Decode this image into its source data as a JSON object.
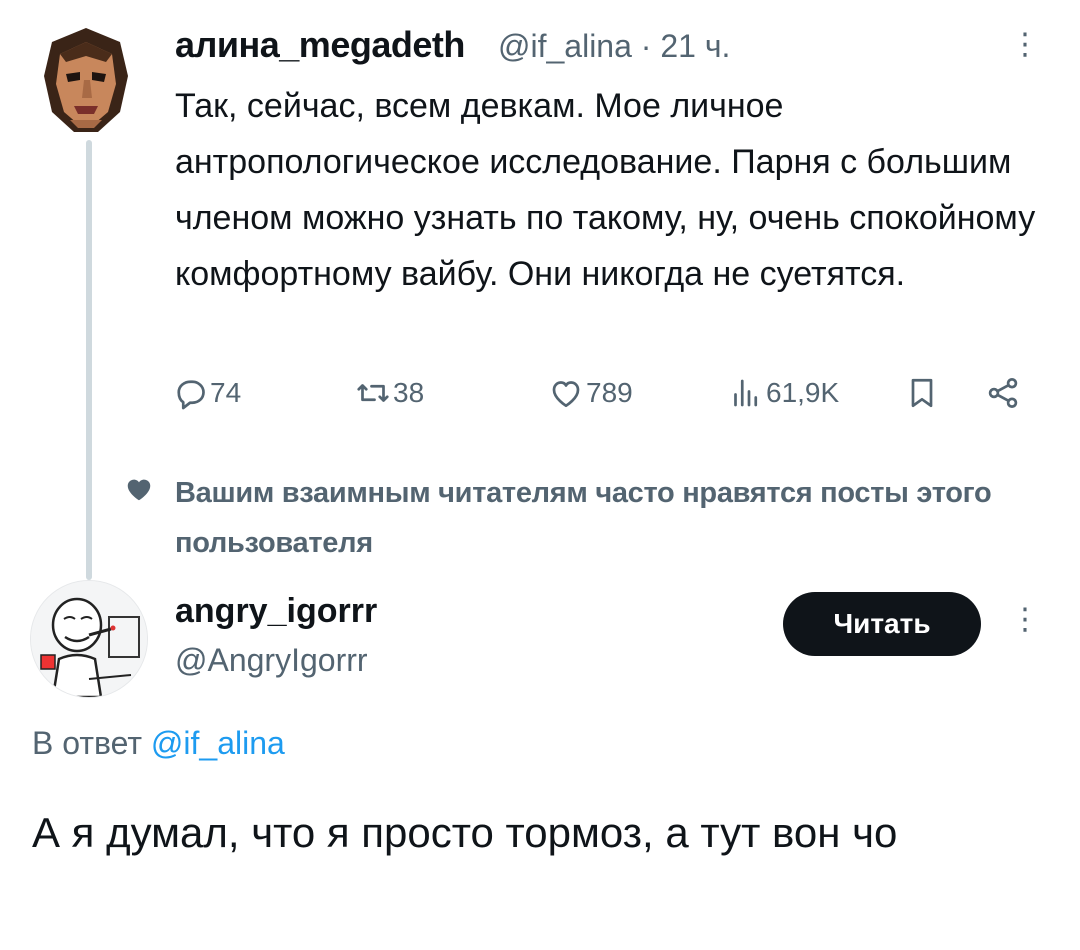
{
  "tweet": {
    "author_name": "алина_megadeth",
    "author_handle": "@if_alina",
    "time": "· 21 ч.",
    "more_label": "⋮",
    "text": "Так, сейчас, всем девкам. Мое личное антропологическое исследование. Парня с большим членом можно узнать по такому, ну, очень спокойному комфортному вайбу. Они никогда не суетятся.",
    "actions": {
      "replies": "74",
      "reposts": "38",
      "likes": "789",
      "views": "61,9K"
    }
  },
  "hint": {
    "text": "Вашим взаимным читателям часто нравятся посты этого пользователя"
  },
  "reply": {
    "author_name": "angry_igorrr",
    "author_handle": "@AngryIgorrr",
    "follow_label": "Читать",
    "more_label": "⋮",
    "reply_prefix": "В ответ",
    "reply_mention": "@if_alina",
    "text": "А я думал, что я просто тормоз, а тут вон чо"
  },
  "colors": {
    "text": "#0f1419",
    "secondary": "#536471",
    "accent": "#1d9bf0",
    "thread_line": "#cfd9de"
  },
  "icons": {
    "reply": "reply-icon",
    "repost": "repost-icon",
    "like": "heart-icon",
    "views": "views-icon",
    "bookmark": "bookmark-icon",
    "share": "share-icon"
  }
}
